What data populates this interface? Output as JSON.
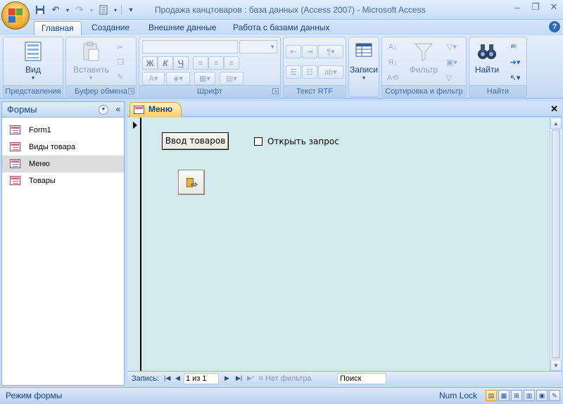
{
  "window": {
    "title": "Продажа канцтоваров : база данных (Access 2007)  -  Microsoft Access",
    "controls": [
      "‒",
      "❐",
      "✕"
    ]
  },
  "quick_access": [
    "save-icon",
    "undo-icon",
    "redo-icon",
    "view-icon",
    "customize-icon"
  ],
  "ribbon": {
    "tabs": [
      "Главная",
      "Создание",
      "Внешние данные",
      "Работа с базами данных"
    ],
    "active_tab": "Главная",
    "groups": {
      "views": {
        "label": "Представления",
        "view_button": "Вид"
      },
      "clipboard": {
        "label": "Буфер обмена",
        "paste_button": "Вставить"
      },
      "font": {
        "label": "Шрифт",
        "bold": "Ж",
        "italic": "К",
        "underline": "Ч"
      },
      "rich_text": {
        "label": "Текст RTF"
      },
      "records": {
        "label": "",
        "records_button": "Записи"
      },
      "sort_filter": {
        "label": "Сортировка и фильтр",
        "filter_button": "Фильтр"
      },
      "find": {
        "label": "Найти",
        "find_button": "Найти"
      }
    }
  },
  "nav_pane": {
    "title": "Формы",
    "items": [
      {
        "label": "Form1"
      },
      {
        "label": "Виды товара"
      },
      {
        "label": "Меню",
        "selected": true
      },
      {
        "label": "Товары"
      }
    ]
  },
  "document": {
    "tab_label": "Меню",
    "form": {
      "input_button": "Ввод товаров",
      "checkbox_label": "Открыть запрос",
      "checkbox_checked": false
    },
    "record_nav": {
      "label": "Запись:",
      "record_value": "1 из 1",
      "filter_status": "Нет фильтра",
      "search_placeholder": "Поиск"
    }
  },
  "status_bar": {
    "mode": "Режим формы",
    "numlock": "Num Lock"
  },
  "colors": {
    "form_background": "#d3ebee",
    "ribbon_background": "#d1e1f6",
    "active_tab": "#ffcf63"
  }
}
